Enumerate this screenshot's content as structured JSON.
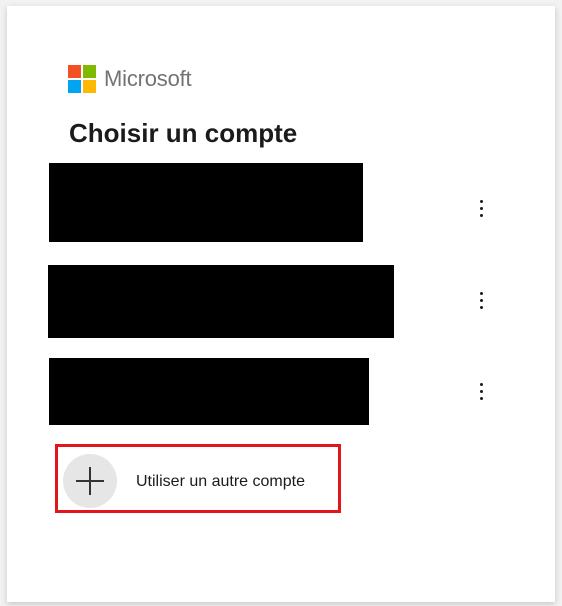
{
  "brand": {
    "name": "Microsoft",
    "logo_colors": [
      "#f25022",
      "#7fba00",
      "#00a4ef",
      "#ffb900"
    ]
  },
  "title": "Choisir un compte",
  "accounts": [
    {
      "redacted": true,
      "menu_icon": "more-vertical-icon"
    },
    {
      "redacted": true,
      "menu_icon": "more-vertical-icon"
    },
    {
      "redacted": true,
      "menu_icon": "more-vertical-icon"
    }
  ],
  "other_account": {
    "label": "Utiliser un autre compte",
    "icon": "plus-icon",
    "highlight_color": "#e3151a"
  }
}
